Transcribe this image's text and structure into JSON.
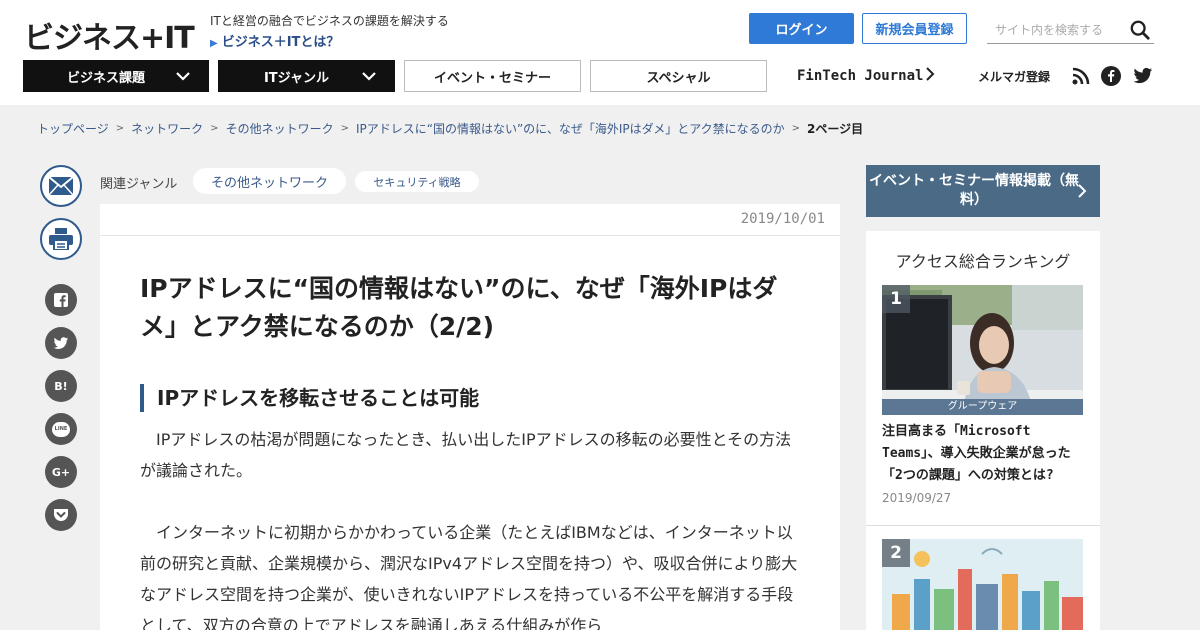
{
  "header": {
    "logo": "ビジネス+IT",
    "tagline": "ITと経営の融合でビジネスの課題を解決する",
    "about_link": "ビジネス＋ITとは？",
    "login_label": "ログイン",
    "register_label": "新規会員登録",
    "search_placeholder": "サイト内を検索する"
  },
  "nav": {
    "business": "ビジネス課題",
    "it_genre": "ITジャンル",
    "event": "イベント・セミナー",
    "special": "スペシャル",
    "fintech": "FinTech Journal",
    "merumaga": "メルマガ登録"
  },
  "breadcrumb": {
    "items": [
      "トップページ",
      "ネットワーク",
      "その他ネットワーク",
      "IPアドレスに“国の情報はない”のに、なぜ「海外IPはダメ」とアク禁になるのか"
    ],
    "current": "2ページ目"
  },
  "share": {
    "hatena": "B!",
    "line": "LINE",
    "gplus": "G+"
  },
  "genre": {
    "label": "関連ジャンル",
    "tags": [
      "その他ネットワーク",
      "セキュリティ戦略"
    ]
  },
  "article": {
    "date": "2019/10/01",
    "title": "IPアドレスに“国の情報はない”のに、なぜ「海外IPはダメ」とアク禁になるのか（2/2)",
    "subhead": "IPアドレスを移転させることは可能",
    "para1": "　IPアドレスの枯渇が問題になったとき、払い出したIPアドレスの移転の必要性とその方法が議論された。",
    "para2": "　インターネットに初期からかかわっている企業（たとえばIBMなどは、インターネット以前の研究と貢献、企業規模から、潤沢なIPv4アドレス空間を持つ）や、吸収合併により膨大なアドレス空間を持つ企業が、使いきれないIPアドレスを持っている不公平を解消する手段として、双方の合意の上でアドレスを融通しあえる仕組みが作ら"
  },
  "sidebar": {
    "event_button": "イベント・セミナー情報掲載（無料）",
    "ranking_title": "アクセス総合ランキング",
    "ranking": [
      {
        "rank": "1",
        "category": "グループウェア",
        "title": "注目高まる「Microsoft Teams」、導入失敗企業が怠った「2つの課題」への対策とは?",
        "date": "2019/09/27"
      },
      {
        "rank": "2"
      }
    ]
  },
  "colors": {
    "primary_blue": "#2f7ad6",
    "navy": "#2f5a8c",
    "link": "#3a5a8a",
    "nav_dark": "#111111",
    "sidebar_button": "#4a6a86"
  }
}
